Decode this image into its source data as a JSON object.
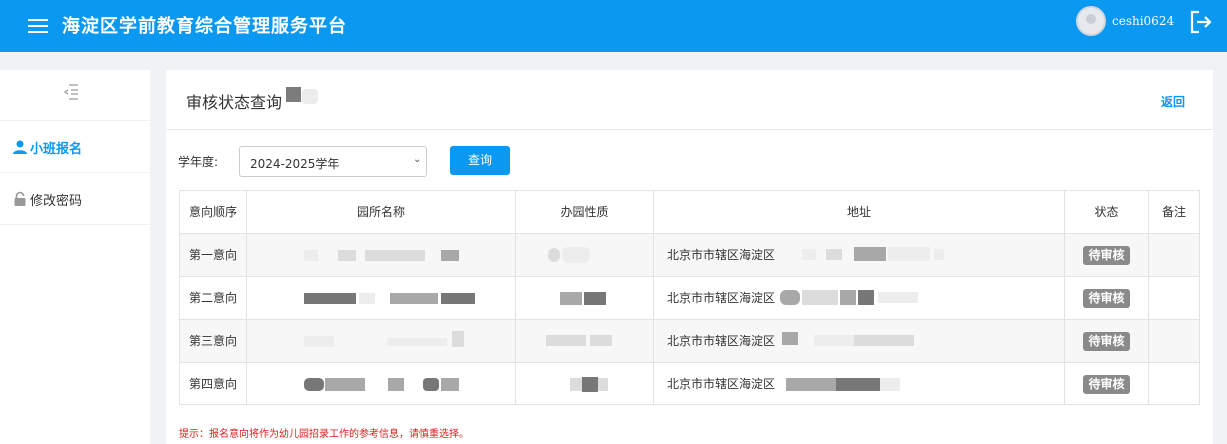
{
  "header": {
    "title": "海淀区学前教育综合管理服务平台",
    "username": "ceshi0624",
    "menu_icon": "hamburger-menu-icon",
    "logout_icon": "logout-icon",
    "background_color": "#0a98f0"
  },
  "sidebar": {
    "collapse_icon": "collapse-sidebar-icon",
    "items": [
      {
        "label": "小班报名",
        "icon": "user-icon",
        "active": true,
        "active_color": "#0a98f0"
      },
      {
        "label": "修改密码",
        "icon": "lock-icon",
        "active": false
      }
    ]
  },
  "page": {
    "title": "审核状态查询",
    "back_label": "返回"
  },
  "filter": {
    "year_label": "学年度:",
    "year_value": "2024-2025学年",
    "query_label": "查询"
  },
  "table": {
    "columns": [
      "意向顺序",
      "园所名称",
      "办园性质",
      "地址",
      "状态",
      "备注"
    ],
    "rows": [
      {
        "order": "第一意向",
        "address_prefix": "北京市市辖区海淀区",
        "status": "待审核",
        "remark": ""
      },
      {
        "order": "第二意向",
        "address_prefix": "北京市市辖区海淀区",
        "status": "待审核",
        "remark": ""
      },
      {
        "order": "第三意向",
        "address_prefix": "北京市市辖区海淀区",
        "status": "待审核",
        "remark": ""
      },
      {
        "order": "第四意向",
        "address_prefix": "北京市市辖区海淀区",
        "status": "待审核",
        "remark": ""
      }
    ]
  },
  "tip": "提示：报名意向将作为幼儿园招录工作的参考信息，请慎重选择。",
  "colors": {
    "accent": "#0a98f0",
    "status_badge": "#8a8a8a",
    "tip_text": "#e02020"
  }
}
